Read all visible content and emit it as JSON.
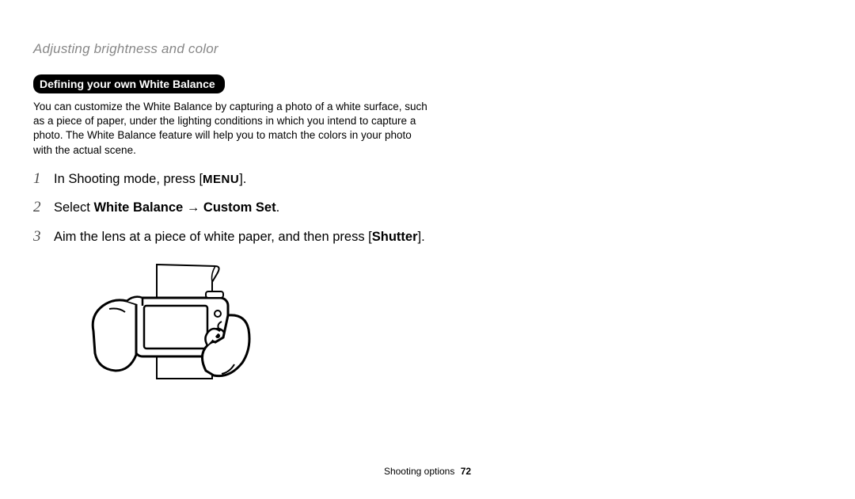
{
  "breadcrumb": "Adjusting brightness and color",
  "sub_badge": "Defining your own White Balance",
  "intro": "You can customize the White Balance by capturing a photo of a white surface, such as a piece of paper, under the lighting conditions in which you intend to capture a photo. The White Balance feature will help you to match the colors in your photo with the actual scene.",
  "steps": {
    "s1_num": "1",
    "s1_pre": "In Shooting mode, press [",
    "s1_menu": "MENU",
    "s1_post": "].",
    "s2_num": "2",
    "s2_pre": "Select ",
    "s2_bold1": "White Balance",
    "s2_arrow": " → ",
    "s2_bold2": "Custom Set",
    "s2_post": ".",
    "s3_num": "3",
    "s3_pre": "Aim the lens at a piece of white paper, and then press [",
    "s3_bold": "Shutter",
    "s3_post": "]."
  },
  "footer_label": "Shooting options",
  "footer_page": "72"
}
